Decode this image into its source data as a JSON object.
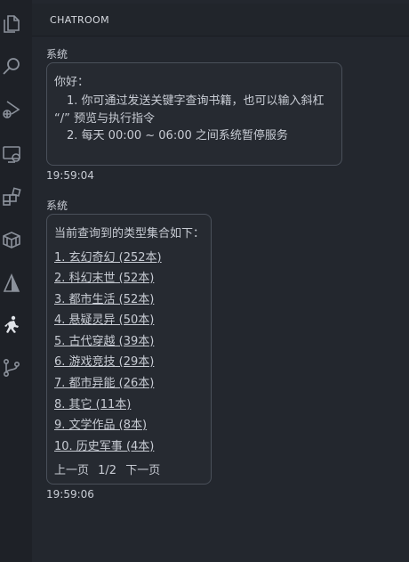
{
  "panel": {
    "title": "CHATROOM"
  },
  "activity_bar": {
    "icons": [
      "files-icon",
      "search-icon",
      "run-debug-icon",
      "remote-explorer-icon",
      "extensions-icon",
      "package-icon",
      "shape-icon",
      "runner-icon",
      "source-control-icon"
    ]
  },
  "messages": [
    {
      "sender": "系统",
      "greeting": "你好：",
      "lines": [
        "1. 你可通过发送关键字查询书籍，也可以输入斜杠",
        "“/” 预览与执行指令",
        "2. 每天 00:00 ~ 06:00 之间系统暂停服务"
      ],
      "time": "19:59:04"
    },
    {
      "sender": "系统",
      "intro": "当前查询到的类型集合如下：",
      "categories": [
        "1. 玄幻奇幻 (252本)",
        "2. 科幻末世 (52本)",
        "3. 都市生活 (52本)",
        "4. 悬疑灵异 (50本)",
        "5. 古代穿越 (39本)",
        "6. 游戏竞技 (29本)",
        "7. 都市异能 (26本)",
        "8. 其它 (11本)",
        "9. 文学作品 (8本)",
        "10. 历史军事 (4本)"
      ],
      "pager": {
        "prev": "上一页",
        "page": "1/2",
        "next": "下一页"
      },
      "time": "19:59:06"
    }
  ],
  "colors": {
    "background": "#1e2127",
    "panel": "#23272e",
    "border": "#4a505a",
    "text": "#c8ccd4"
  }
}
